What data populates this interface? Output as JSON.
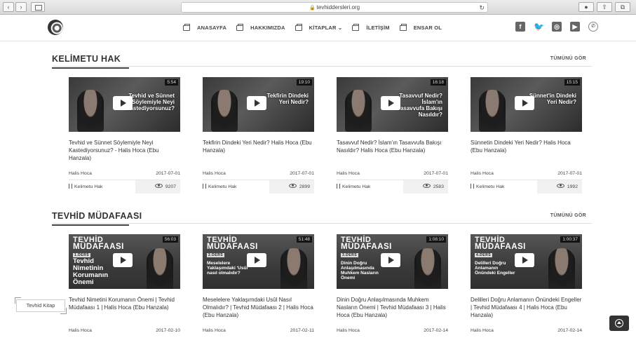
{
  "browser": {
    "url": "tevhiddersleri.org",
    "back_icon": "chevron-left-icon",
    "forward_icon": "chevron-right-icon"
  },
  "nav": {
    "items": [
      {
        "label": "ANASAYFA"
      },
      {
        "label": "HAKKIMIZDA"
      },
      {
        "label": "KİTAPLAR ⌄"
      },
      {
        "label": "İLETİŞİM"
      },
      {
        "label": "ENSAR OL"
      }
    ]
  },
  "social": [
    "facebook-icon",
    "twitter-icon",
    "instagram-icon",
    "youtube-icon",
    "whatsapp-icon"
  ],
  "sections": [
    {
      "title": "KELİMETU HAK",
      "see_all": "TÜMÜNÜ GÖR",
      "cards": [
        {
          "duration": "5:54",
          "overlay": "Tevhid ve Sünnet Söylemiyle Neyi Kastediyorsunuz?",
          "title": "Tevhid ve Sünnet Söylemiyle Neyi Kastediyorsunuz? - Halis Hoca (Ebu Hanzala)",
          "author": "Halis Hoca",
          "date": "2017-07-01",
          "category": "Kelimetu Hak",
          "views": "9207"
        },
        {
          "duration": "19:10",
          "overlay": "Tekfirin Dindeki Yeri Nedir?",
          "title": "Tekfirin Dindeki Yeri Nedir? Halis Hoca (Ebu Hanzala)",
          "author": "Halis Hoca",
          "date": "2017-07-01",
          "category": "Kelimetu Hak",
          "views": "2899"
        },
        {
          "duration": "16:18",
          "overlay": "Tasavvuf Nedir? İslam'ın Tasavvufa Bakışı Nasıldır?",
          "title": "Tasavvuf Nedir? İslam'ın Tasavvufa Bakışı Nasıldır? Halis Hoca (Ebu Hanzala)",
          "author": "Halis Hoca",
          "date": "2017-07-01",
          "category": "Kelimetu Hak",
          "views": "2583"
        },
        {
          "duration": "15:15",
          "overlay": "Sünnet'in Dindeki Yeri Nedir?",
          "title": "Sünnetin Dindeki Yeri Nedir? Halis Hoca (Ebu Hanzala)",
          "author": "Halis Hoca",
          "date": "2017-07-01",
          "category": "Kelimetu Hak",
          "views": "1992"
        }
      ]
    },
    {
      "title": "TEVHİD MÜDAFAASI",
      "see_all": "TÜMÜNÜ GÖR",
      "brand_1": "TEVHİD",
      "brand_2": "MÜDAFAASI",
      "cards": [
        {
          "duration": "56:03",
          "lesson": "1.DERS",
          "overlay": "Tevhid Nimetinin Korumanın Önemi",
          "title": "Tevhid Nimetini Korumanın Önemi | Tevhid Müdafaası 1 | Halis Hoca (Ebu Hanzala)",
          "author": "Halis Hoca",
          "date": "2017-02-10"
        },
        {
          "duration": "51:48",
          "lesson": "2.DERS",
          "overlay": "Meselelere Yaklaşımdaki 'Usûl' nasıl olmalıdır?",
          "title": "Meselelere Yaklaşımdaki Usûl Nasıl Olmalıdır? | Tevhid Müdafaası 2 | Halis Hoca (Ebu Hanzala)",
          "author": "Halis Hoca",
          "date": "2017-02-11"
        },
        {
          "duration": "1:08:10",
          "lesson": "3.DERS",
          "overlay": "Dinin Doğru Anlaşılmasında Muhkem Nasların Önemi",
          "title": "Dinin Doğru Anlaşılmasında Muhkem Nasların Önemi | Tevhid Müdafaası 3 | Halis Hoca (Ebu Hanzala)",
          "author": "Halis Hoca",
          "date": "2017-02-14"
        },
        {
          "duration": "1:00:37",
          "lesson": "4.DERS",
          "overlay": "Delilleri Doğru Anlamanın Önündeki Engeller",
          "title": "Delilleri Doğru Anlamanın Önündeki Engeller | Tevhid Müdafaası 4 | Halis Hoca (Ebu Hanzala)",
          "author": "Halis Hoca",
          "date": "2017-02-14"
        }
      ]
    }
  ],
  "floating_label": "Tevhid Kitap",
  "colors": {
    "accent": "#333333",
    "chrome": "#dcdcdc"
  }
}
